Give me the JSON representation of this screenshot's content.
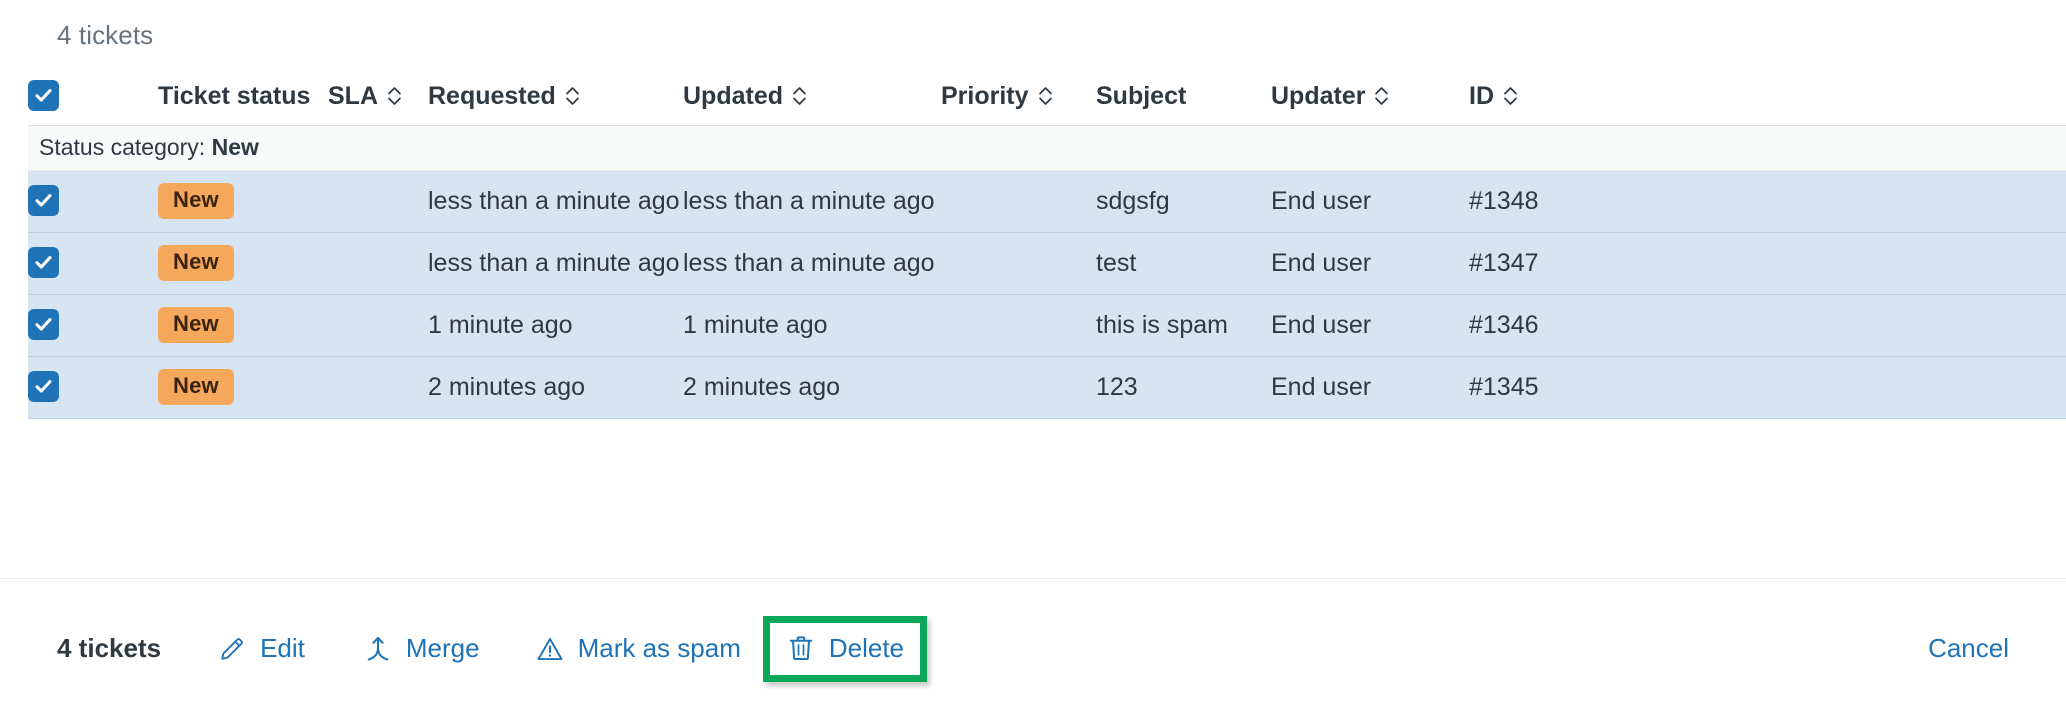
{
  "header": {
    "count_label": "4 tickets"
  },
  "table": {
    "select_all_checked": true,
    "columns": [
      {
        "key": "checkbox",
        "label": "",
        "sortable": false
      },
      {
        "key": "ticket_status",
        "label": "Ticket status",
        "sortable": false
      },
      {
        "key": "sla",
        "label": "SLA",
        "sortable": true
      },
      {
        "key": "requested",
        "label": "Requested",
        "sortable": true
      },
      {
        "key": "updated",
        "label": "Updated",
        "sortable": true
      },
      {
        "key": "priority",
        "label": "Priority",
        "sortable": true
      },
      {
        "key": "subject",
        "label": "Subject",
        "sortable": false
      },
      {
        "key": "updater",
        "label": "Updater",
        "sortable": true
      },
      {
        "key": "id",
        "label": "ID",
        "sortable": true
      }
    ],
    "group": {
      "prefix": "Status category: ",
      "value": "New"
    },
    "rows": [
      {
        "checked": true,
        "status": "New",
        "sla": "",
        "requested": "less than a minute ago",
        "updated": "less than a minute ago",
        "priority": "",
        "subject": "sdgsfg",
        "updater": "End user",
        "id": "#1348"
      },
      {
        "checked": true,
        "status": "New",
        "sla": "",
        "requested": "less than a minute ago",
        "updated": "less than a minute ago",
        "priority": "",
        "subject": "test",
        "updater": "End user",
        "id": "#1347"
      },
      {
        "checked": true,
        "status": "New",
        "sla": "",
        "requested": "1 minute ago",
        "updated": "1 minute ago",
        "priority": "",
        "subject": "this is spam",
        "updater": "End user",
        "id": "#1346"
      },
      {
        "checked": true,
        "status": "New",
        "sla": "",
        "requested": "2 minutes ago",
        "updated": "2 minutes ago",
        "priority": "",
        "subject": "123",
        "updater": "End user",
        "id": "#1345"
      }
    ]
  },
  "footer": {
    "count_label": "4 tickets",
    "actions": [
      {
        "icon": "pencil-icon",
        "label": "Edit"
      },
      {
        "icon": "merge-icon",
        "label": "Merge"
      },
      {
        "icon": "warning-triangle-icon",
        "label": "Mark as spam"
      },
      {
        "icon": "trash-icon",
        "label": "Delete"
      }
    ],
    "cancel_label": "Cancel",
    "highlighted_action": "Delete"
  },
  "colors": {
    "accent_blue": "#1f73b7",
    "selected_row": "#d7e4f2",
    "badge_orange": "#f5a85c",
    "badge_text": "#3b2511",
    "highlight_green": "#0aa75a",
    "text_dark": "#2f3941",
    "text_muted": "#68737d"
  }
}
